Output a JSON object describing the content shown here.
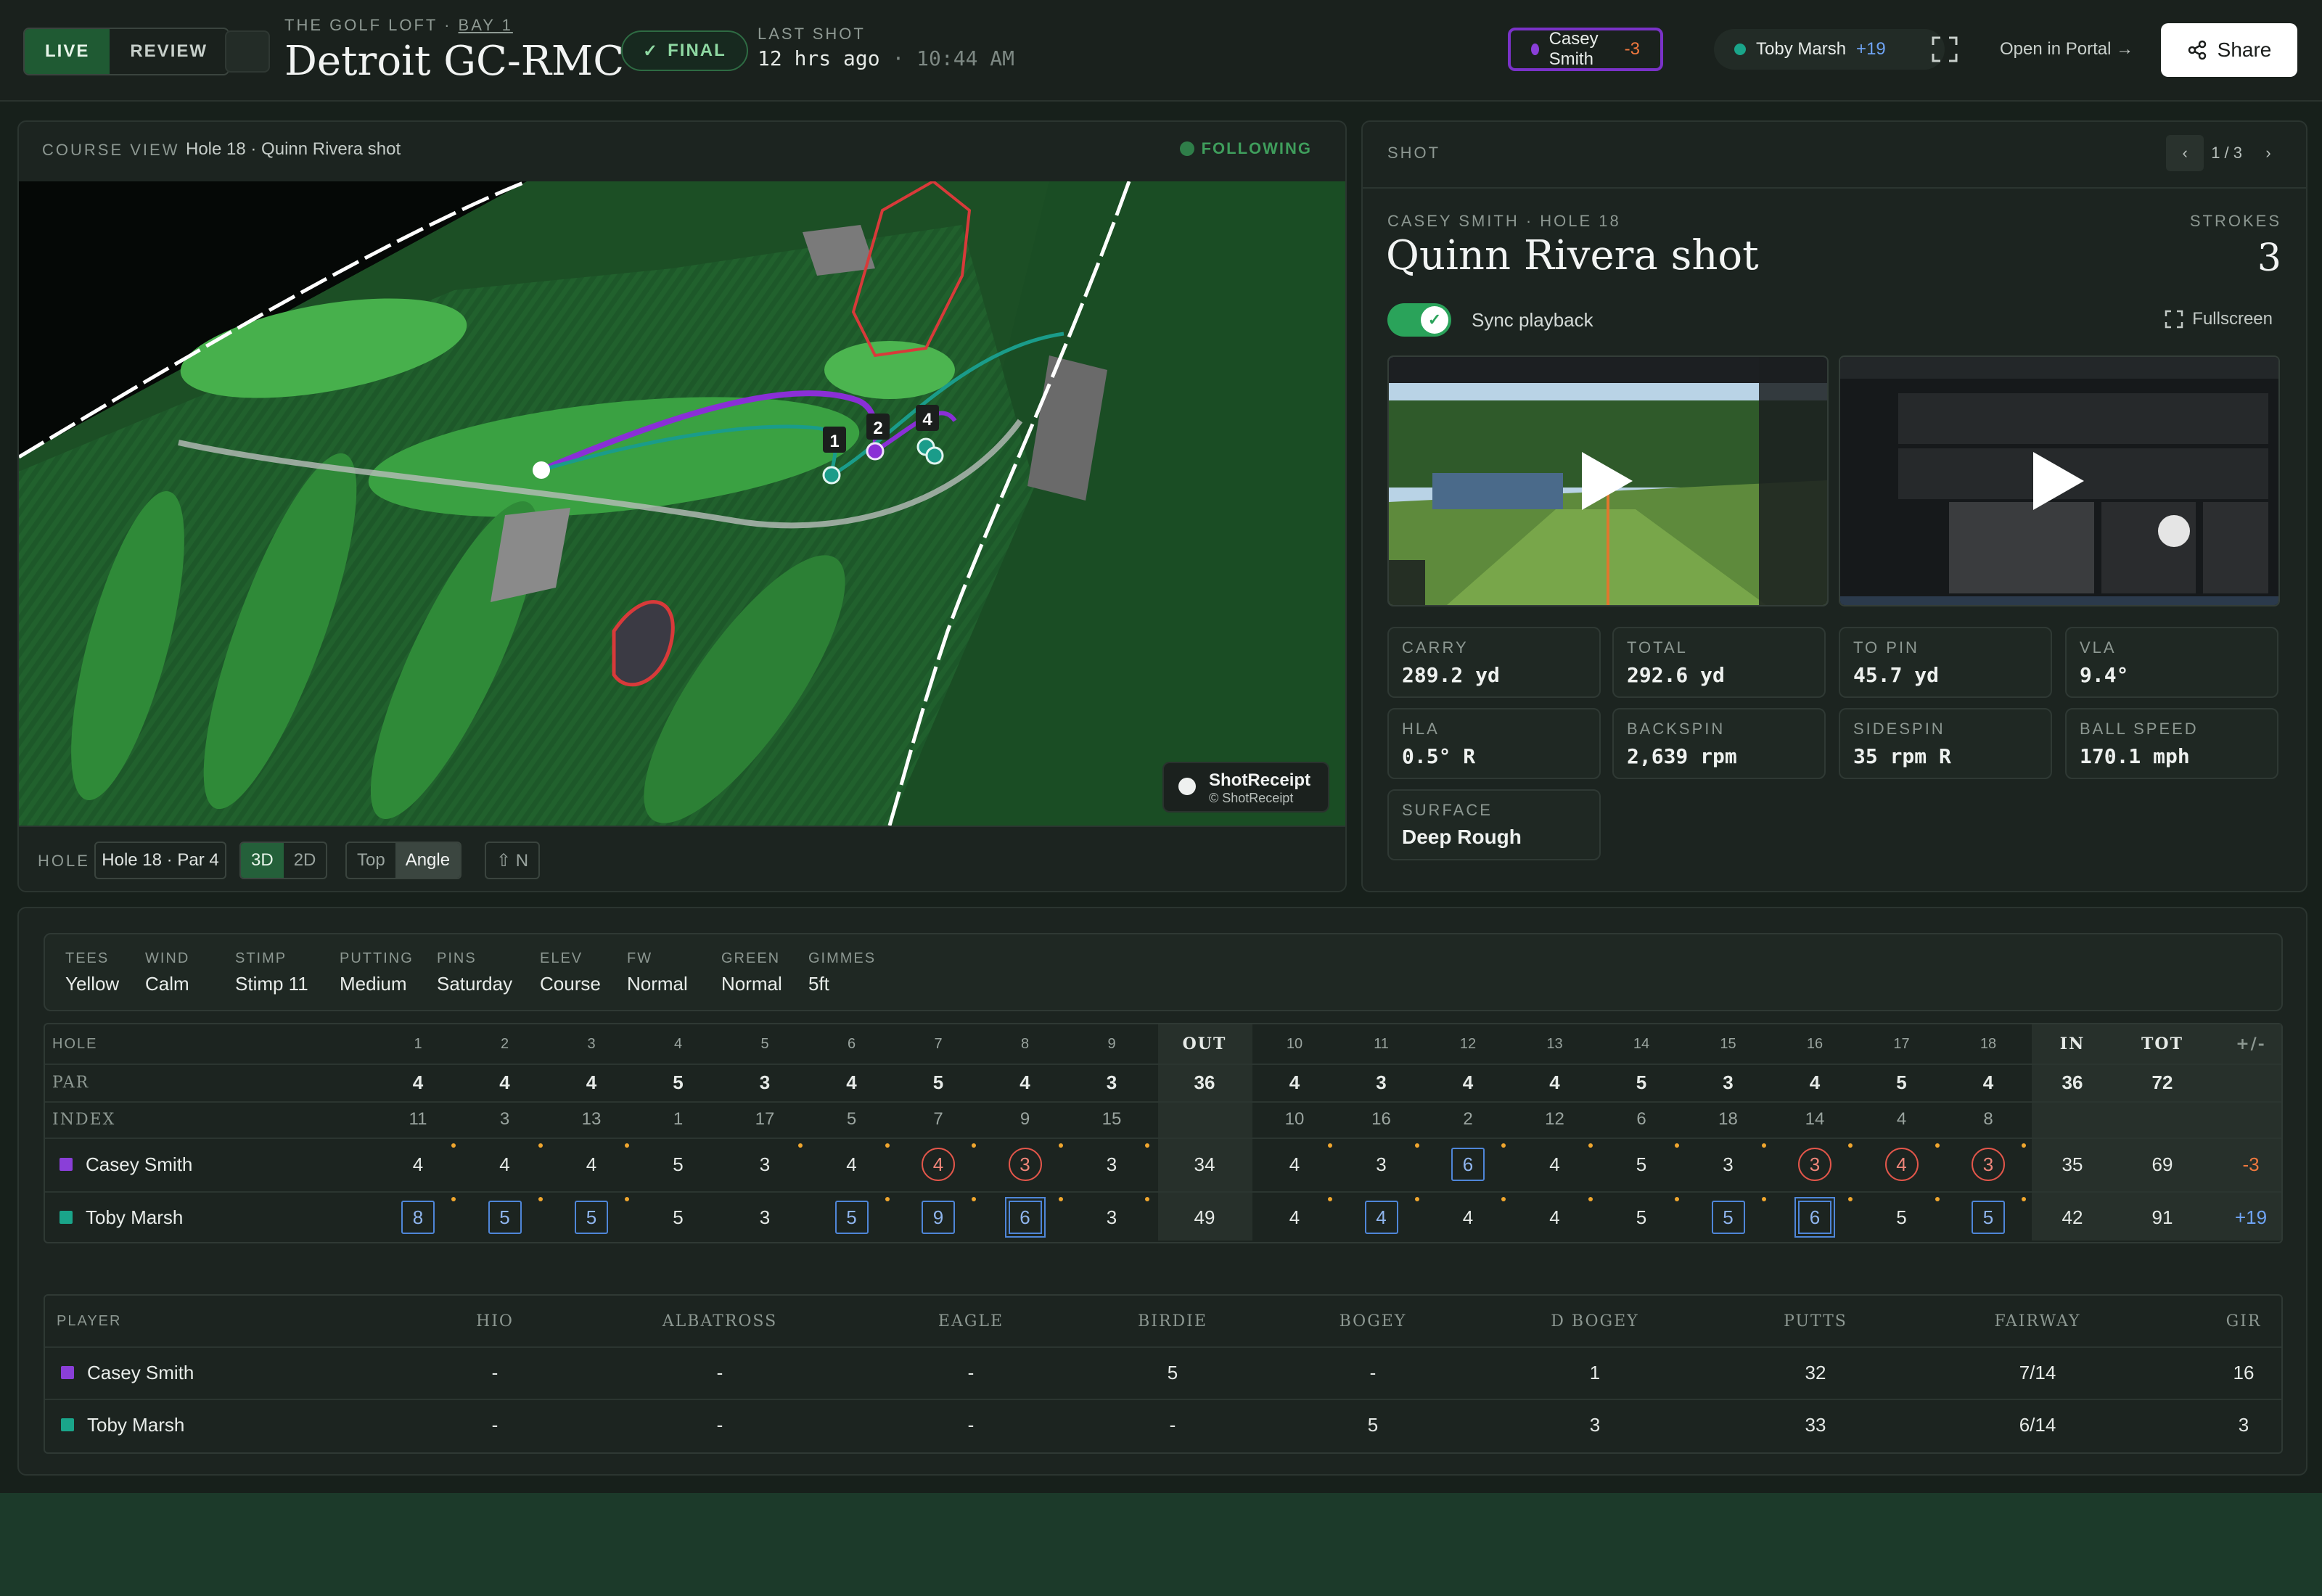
{
  "header": {
    "mode_tabs": [
      "LIVE",
      "REVIEW"
    ],
    "venue": "THE GOLF LOFT",
    "bay": "BAY 1",
    "course_title": "Detroit GC-RMC",
    "status_badge": "FINAL",
    "last_shot_label": "LAST SHOT",
    "last_shot_ago": "12 hrs ago",
    "last_shot_sep": "·",
    "last_shot_time": "10:44 AM",
    "players": [
      {
        "name": "Casey Smith",
        "score": "-3",
        "color": "#8a3fd8"
      },
      {
        "name": "Toby Marsh",
        "score": "+19",
        "color": "#1aa58a"
      }
    ],
    "portal_link": "Open in Portal →",
    "share_label": "Share"
  },
  "course_view": {
    "label": "COURSE VIEW",
    "subtitle": "Hole 18 · Quinn Rivera shot",
    "following": "FOLLOWING",
    "badge_title": "ShotReceipt",
    "badge_sub": "© ShotReceipt",
    "hole_label": "HOLE",
    "hole_select": "Hole 18 · Par 4",
    "dims": [
      "3D",
      "2D"
    ],
    "views": [
      "Top",
      "Angle"
    ],
    "north": "⇧ N",
    "markers": [
      "1",
      "2",
      "4"
    ]
  },
  "shot": {
    "label": "SHOT",
    "pager": "1 / 3",
    "meta": "CASEY SMITH · HOLE 18",
    "title": "Quinn Rivera shot",
    "strokes_label": "STROKES",
    "strokes": "3",
    "sync_label": "Sync playback",
    "fullscreen_label": "Fullscreen",
    "metrics": [
      {
        "label": "CARRY",
        "value": "289.2 yd"
      },
      {
        "label": "TOTAL",
        "value": "292.6 yd"
      },
      {
        "label": "TO PIN",
        "value": "45.7 yd"
      },
      {
        "label": "VLA",
        "value": "9.4°"
      },
      {
        "label": "HLA",
        "value": "0.5° R"
      },
      {
        "label": "BACKSPIN",
        "value": "2,639 rpm"
      },
      {
        "label": "SIDESPIN",
        "value": "35 rpm R"
      },
      {
        "label": "BALL SPEED",
        "value": "170.1 mph"
      },
      {
        "label": "SURFACE",
        "value": "Deep Rough"
      }
    ]
  },
  "conditions": [
    {
      "label": "TEES",
      "value": "Yellow"
    },
    {
      "label": "WIND",
      "value": "Calm"
    },
    {
      "label": "STIMP",
      "value": "Stimp 11"
    },
    {
      "label": "PUTTING",
      "value": "Medium"
    },
    {
      "label": "PINS",
      "value": "Saturday"
    },
    {
      "label": "ELEV",
      "value": "Course"
    },
    {
      "label": "FW",
      "value": "Normal"
    },
    {
      "label": "GREEN",
      "value": "Normal"
    },
    {
      "label": "GIMMES",
      "value": "5ft"
    }
  ],
  "scorecard": {
    "header_label": "HOLE",
    "out_label": "OUT",
    "in_label": "IN",
    "tot_label": "TOT",
    "diff_label": "+/-",
    "holes": [
      "1",
      "2",
      "3",
      "4",
      "5",
      "6",
      "7",
      "8",
      "9",
      "10",
      "11",
      "12",
      "13",
      "14",
      "15",
      "16",
      "17",
      "18"
    ],
    "par_label": "PAR",
    "par": [
      "4",
      "4",
      "4",
      "5",
      "3",
      "4",
      "5",
      "4",
      "3",
      "4",
      "3",
      "4",
      "4",
      "5",
      "3",
      "4",
      "5",
      "4"
    ],
    "par_out": "36",
    "par_in": "36",
    "par_tot": "72",
    "index_label": "INDEX",
    "index": [
      "11",
      "3",
      "13",
      "1",
      "17",
      "5",
      "7",
      "9",
      "15",
      "10",
      "16",
      "2",
      "12",
      "6",
      "18",
      "14",
      "4",
      "8"
    ],
    "players": [
      {
        "name": "Casey Smith",
        "color": "#8a3fd8",
        "scores": [
          "4",
          "4",
          "4",
          "5",
          "3",
          "4",
          "4",
          "3",
          "3",
          "4",
          "3",
          "6",
          "4",
          "5",
          "3",
          "3",
          "4",
          "3"
        ],
        "marks": [
          "",
          "",
          "",
          "",
          "",
          "",
          "c",
          "c",
          "",
          "",
          "",
          "sq",
          "",
          "",
          "",
          "c",
          "c",
          "c"
        ],
        "putts": [
          1,
          1,
          1,
          0,
          1,
          1,
          1,
          1,
          1,
          1,
          1,
          1,
          1,
          1,
          1,
          1,
          1,
          1
        ],
        "out": "34",
        "in": "35",
        "tot": "69",
        "diff": "-3"
      },
      {
        "name": "Toby Marsh",
        "color": "#1aa58a",
        "scores": [
          "8",
          "5",
          "5",
          "5",
          "3",
          "5",
          "9",
          "6",
          "3",
          "4",
          "4",
          "4",
          "4",
          "5",
          "5",
          "6",
          "5",
          "5"
        ],
        "marks": [
          "sq",
          "sq",
          "sq",
          "",
          "",
          "sq",
          "sq",
          "sqd",
          "",
          "",
          "sq",
          "",
          "",
          "",
          "sq",
          "sqd",
          "",
          "sq"
        ],
        "putts": [
          1,
          1,
          1,
          0,
          0,
          1,
          1,
          1,
          1,
          1,
          1,
          1,
          1,
          1,
          1,
          1,
          1,
          1
        ],
        "out": "49",
        "in": "42",
        "tot": "91",
        "diff": "+19"
      }
    ]
  },
  "stats": {
    "headers": [
      "PLAYER",
      "HIO",
      "ALBATROSS",
      "EAGLE",
      "BIRDIE",
      "BOGEY",
      "D BOGEY",
      "PUTTS",
      "FAIRWAY",
      "GIR"
    ],
    "rows": [
      {
        "name": "Casey Smith",
        "color": "#8a3fd8",
        "values": [
          "-",
          "-",
          "-",
          "5",
          "-",
          "1",
          "32",
          "7/14",
          "16"
        ]
      },
      {
        "name": "Toby Marsh",
        "color": "#1aa58a",
        "values": [
          "-",
          "-",
          "-",
          "-",
          "5",
          "3",
          "33",
          "6/14",
          "3"
        ]
      }
    ]
  }
}
